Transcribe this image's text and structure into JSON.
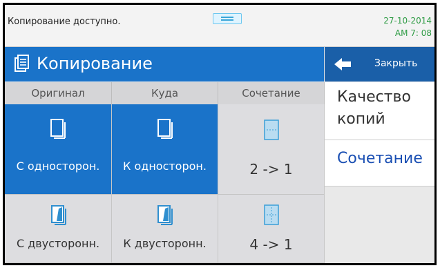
{
  "status": {
    "message": "Копирование доступно.",
    "date": "27-10-2014",
    "time": "AM 7: 08"
  },
  "title": {
    "text": "Копирование",
    "icon": "copy-document-icon"
  },
  "close": {
    "label": "Закрыть",
    "icon": "back-arrow-icon"
  },
  "columns": [
    "Оригинал",
    "Куда",
    "Сочетание"
  ],
  "tiles": {
    "orig_simplex": {
      "label": "С односторон.",
      "icon": "single-sided-page-icon"
    },
    "dest_simplex": {
      "label": "К односторон.",
      "icon": "single-sided-page-icon"
    },
    "combine_2to1": {
      "label": "2 -> 1",
      "icon": "two-in-one-icon"
    },
    "orig_duplex": {
      "label": "С двусторонн.",
      "icon": "double-sided-page-icon"
    },
    "dest_duplex": {
      "label": "К двусторонн.",
      "icon": "double-sided-page-icon"
    },
    "combine_4to1": {
      "label": "4 -> 1",
      "icon": "four-in-one-icon"
    }
  },
  "menu": {
    "quality": "Качество копий",
    "combine": "Сочетание"
  },
  "colors": {
    "accent": "#1a73c9",
    "status_green": "#2d9b43",
    "link_blue": "#1a4fb3"
  }
}
